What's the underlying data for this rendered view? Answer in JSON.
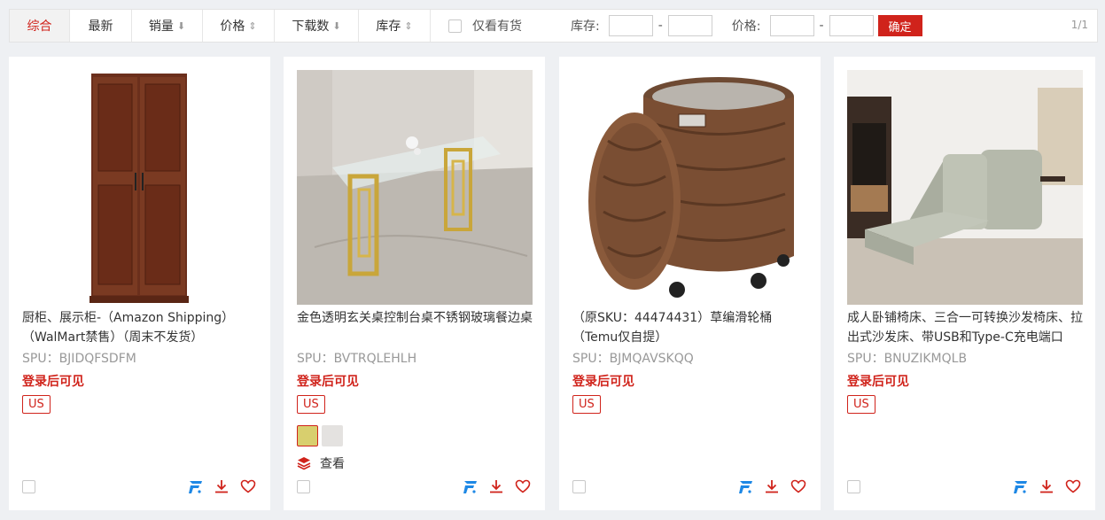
{
  "toolbar": {
    "tabs": [
      {
        "label": "综合",
        "arrow": ""
      },
      {
        "label": "最新",
        "arrow": ""
      },
      {
        "label": "销量",
        "arrow": "⬇"
      },
      {
        "label": "价格",
        "arrow": "⇕"
      },
      {
        "label": "下载数",
        "arrow": "⬇"
      },
      {
        "label": "库存",
        "arrow": "⇕"
      }
    ],
    "in_stock_only": "仅看有货",
    "stock_label": "库存:",
    "price_label": "价格:",
    "dash": "-",
    "confirm": "确定",
    "page_info": "1/1"
  },
  "colors": {
    "accent": "#d0231b",
    "brand_blue": "#1e88e5"
  },
  "products": [
    {
      "title": "厨柜、展示柜-（Amazon Shipping）（WalMart禁售）（周末不发货）",
      "spu": "SPU：BJIDQFSDFM",
      "price_note": "登录后可见",
      "region": "US"
    },
    {
      "title": "金色透明玄关桌控制台桌不锈钢玻璃餐边桌",
      "spu": "SPU：BVTRQLEHLH",
      "price_note": "登录后可见",
      "region": "US",
      "swatch_colors": [
        "#d8cf6e",
        "#e4e2e0"
      ],
      "view_label": "查看"
    },
    {
      "title": "（原SKU：44474431）草编滑轮桶（Temu仅自提）",
      "spu": "SPU：BJMQAVSKQQ",
      "price_note": "登录后可见",
      "region": "US"
    },
    {
      "title": "成人卧铺椅床、三合一可转换沙发椅床、拉出式沙发床、带USB和Type-C充电端口",
      "spu": "SPU：BNUZIKMQLB",
      "price_note": "登录后可见",
      "region": "US"
    }
  ]
}
